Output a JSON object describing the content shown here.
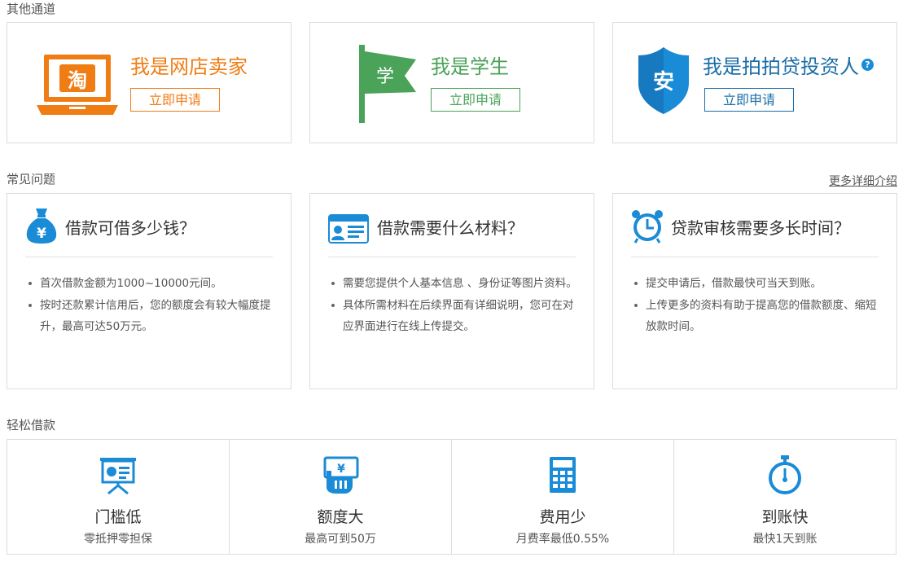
{
  "sections": {
    "channels_title": "其他通道",
    "faq_title": "常见问题",
    "faq_more": "更多详细介绍",
    "easy_title": "轻松借款"
  },
  "channels": [
    {
      "title": "我是网店卖家",
      "button": "立即申请",
      "icon_text": "淘",
      "icon": "laptop-taobao-icon",
      "color": "#f07d14"
    },
    {
      "title": "我是学生",
      "button": "立即申请",
      "icon_text": "学",
      "icon": "flag-student-icon",
      "color": "#4ba259"
    },
    {
      "title": "我是拍拍贷投资人",
      "button": "立即申请",
      "icon_text": "安",
      "icon": "shield-investor-icon",
      "color": "#1a6ea8",
      "help": "?"
    }
  ],
  "faq": [
    {
      "title": "借款可借多少钱？",
      "icon": "money-bag-icon",
      "icon_text": "¥",
      "items": [
        "首次借款金额为1000~10000元间。",
        "按时还款累计信用后，您的额度会有较大幅度提升，最高可达50万元。"
      ]
    },
    {
      "title": "借款需要什么材料？",
      "icon": "id-card-icon",
      "items": [
        "需要您提供个人基本信息 、身份证等图片资料。",
        "具体所需材料在后续界面有详细说明，您可在对应界面进行在线上传提交。"
      ]
    },
    {
      "title": "贷款审核需要多长时间？",
      "icon": "alarm-clock-icon",
      "items": [
        "提交申请后，借款最快可当天到账。",
        "上传更多的资料有助于提高您的借款额度、缩短放款时间。"
      ]
    }
  ],
  "easy": [
    {
      "name": "门槛低",
      "desc": "零抵押零担保",
      "icon": "presentation-board-icon"
    },
    {
      "name": "额度大",
      "desc": "最高可到50万",
      "icon": "hand-cash-icon"
    },
    {
      "name": "费用少",
      "desc": "月费率最低0.55%",
      "icon": "calculator-icon"
    },
    {
      "name": "到账快",
      "desc": "最快1天到账",
      "icon": "stopwatch-icon"
    }
  ],
  "colors": {
    "blue": "#1a8bd6",
    "orange": "#f07d14",
    "green": "#4ba259",
    "dark_blue": "#1a6ea8"
  }
}
